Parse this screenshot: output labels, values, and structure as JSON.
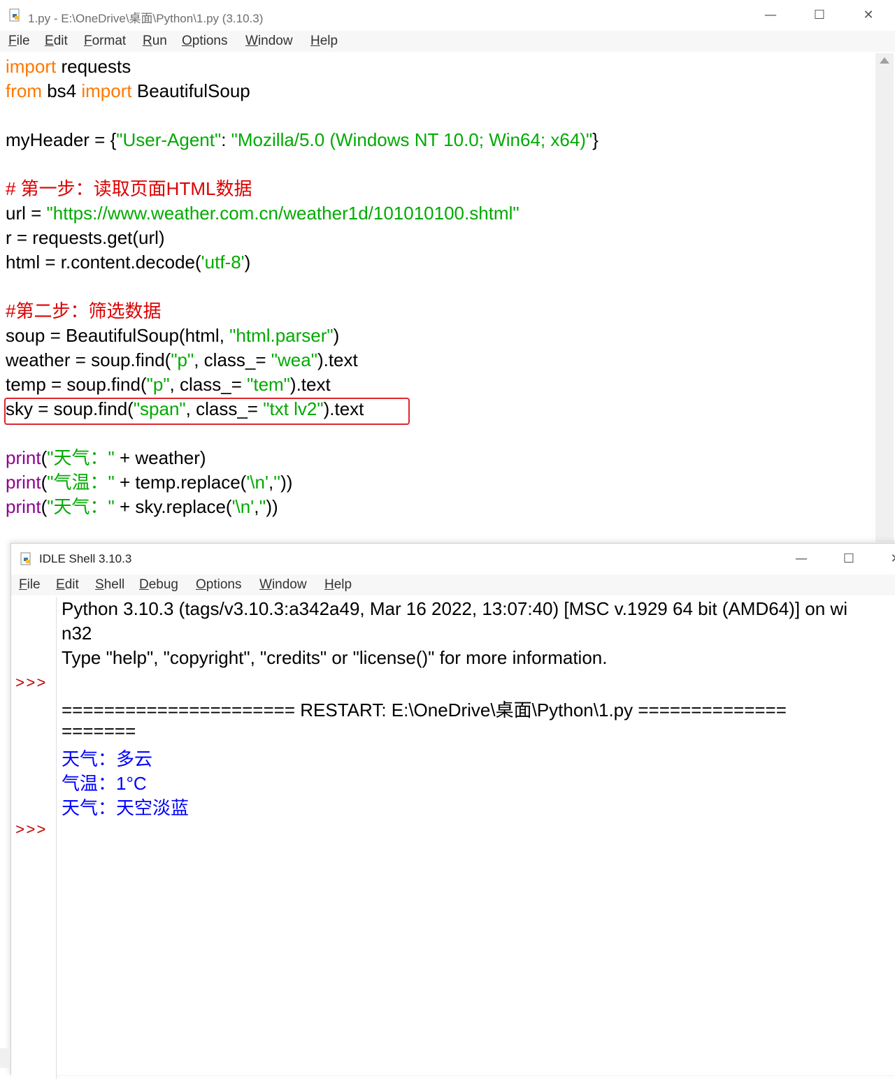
{
  "editor": {
    "title": "1.py - E:\\OneDrive\\桌面\\Python\\1.py (3.10.3)",
    "controls": {
      "minimize": "—",
      "maximize": "☐",
      "close": "✕"
    },
    "menu": [
      "File",
      "Edit",
      "Format",
      "Run",
      "Options",
      "Window",
      "Help"
    ],
    "code": {
      "l1": {
        "kw": "import",
        "rest": " requests"
      },
      "l2": {
        "kw1": "from",
        "mid": " bs4 ",
        "kw2": "import",
        "rest": " BeautifulSoup"
      },
      "l4": {
        "a": "myHeader = {",
        "s1": "\"User-Agent\"",
        "b": ": ",
        "s2": "\"Mozilla/5.0 (Windows NT 10.0; Win64; x64)\"",
        "c": "}"
      },
      "l6": {
        "comment": "# 第一步：读取页面HTML数据"
      },
      "l7": {
        "a": "url = ",
        "s": "\"https://www.weather.com.cn/weather1d/101010100.shtml\""
      },
      "l8": {
        "text": "r = requests.get(url)"
      },
      "l9": {
        "a": "html = r.content.decode(",
        "s": "'utf-8'",
        "b": ")"
      },
      "l11": {
        "comment": "#第二步：筛选数据"
      },
      "l12": {
        "a": "soup = BeautifulSoup(html, ",
        "s": "\"html.parser\"",
        "b": ")"
      },
      "l13": {
        "a": "weather = soup.find(",
        "s1": "\"p\"",
        "b": ", class_= ",
        "s2": "\"wea\"",
        "c": ").text"
      },
      "l14": {
        "a": "temp = soup.find(",
        "s1": "\"p\"",
        "b": ", class_= ",
        "s2": "\"tem\"",
        "c": ").text"
      },
      "l15": {
        "a": "sky = soup.find(",
        "s1": "\"span\"",
        "b": ", class_= ",
        "s2": "\"txt lv2\"",
        "c": ").text"
      },
      "l17": {
        "fn": "print",
        "a": "(",
        "s": "\"天气：\"",
        "b": " + weather)"
      },
      "l18": {
        "fn": "print",
        "a": "(",
        "s": "\"气温：\"",
        "b": " + temp.replace(",
        "s2": "'\\n'",
        "c": ",",
        "s3": "''",
        "d": "))"
      },
      "l19": {
        "fn": "print",
        "a": "(",
        "s": "\"天气：\"",
        "b": " + sky.replace(",
        "s2": "'\\n'",
        "c": ",",
        "s3": "''",
        "d": "))"
      }
    }
  },
  "shell": {
    "title": "IDLE Shell 3.10.3",
    "controls": {
      "minimize": "—",
      "maximize": "☐",
      "close": "✕"
    },
    "menu": [
      "File",
      "Edit",
      "Shell",
      "Debug",
      "Options",
      "Window",
      "Help"
    ],
    "prompt": ">>>",
    "lines": {
      "banner1": "Python 3.10.3 (tags/v3.10.3:a342a49, Mar 16 2022, 13:07:40) [MSC v.1929 64 bit (AMD64)] on wi",
      "banner2": "n32",
      "banner3": "Type \"help\", \"copyright\", \"credits\" or \"license()\" for more information.",
      "restart1": "====================== RESTART: E:\\OneDrive\\桌面\\Python\\1.py ==============",
      "restart2": "=======",
      "out1": "天气：多云",
      "out2": "气温：1°C",
      "out3": "天气：天空淡蓝"
    }
  }
}
